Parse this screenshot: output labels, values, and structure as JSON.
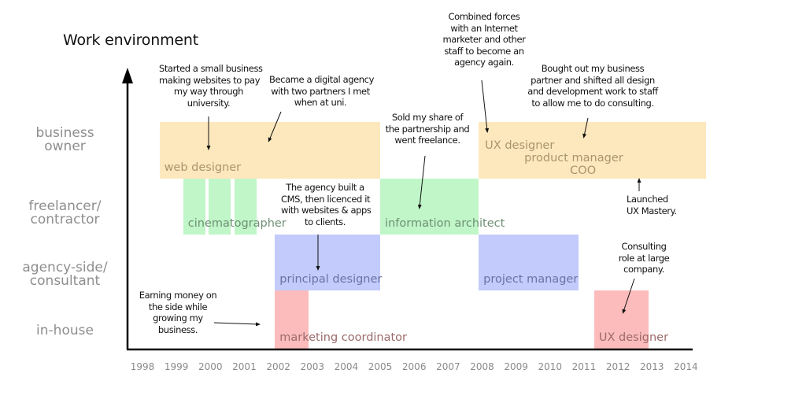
{
  "title": "Work environment",
  "colors": {
    "business_owner": "#fde8bd",
    "freelancer": "#c0f6c8",
    "agency": "#c2cbfb",
    "in_house": "#fcbcbc",
    "label_business_owner": "#a9956b",
    "label_freelancer": "#6f8f74",
    "label_agency": "#6a73a3",
    "label_in_house": "#9c6a6a"
  },
  "rows": [
    {
      "key": "business_owner",
      "label_lines": [
        "business",
        "owner"
      ]
    },
    {
      "key": "freelancer",
      "label_lines": [
        "freelancer/",
        "contractor"
      ]
    },
    {
      "key": "agency",
      "label_lines": [
        "agency-side/",
        "consultant"
      ]
    },
    {
      "key": "in_house",
      "label_lines": [
        "in-house"
      ]
    }
  ],
  "years": [
    "1998",
    "1999",
    "2000",
    "2001",
    "2002",
    "2003",
    "2004",
    "2005",
    "2006",
    "2007",
    "2008",
    "2009",
    "2010",
    "2011",
    "2012",
    "2013",
    "2014"
  ],
  "chart_data": {
    "type": "timeline",
    "title": "Work environment",
    "x_axis": {
      "label": "",
      "range": [
        1998,
        2014
      ]
    },
    "y_axis": {
      "categories": [
        "business owner",
        "freelancer/contractor",
        "agency-side/consultant",
        "in-house"
      ]
    },
    "segments": [
      {
        "row": "business_owner",
        "start": 1998.5,
        "end": 2005.0,
        "label": "web designer"
      },
      {
        "row": "freelancer",
        "start": 1999.2,
        "end": 1999.85,
        "label": "cinematographer"
      },
      {
        "row": "freelancer",
        "start": 1999.95,
        "end": 2000.6,
        "label": ""
      },
      {
        "row": "freelancer",
        "start": 2000.7,
        "end": 2001.35,
        "label": ""
      },
      {
        "row": "agency",
        "start": 2001.9,
        "end": 2005.0,
        "label": "principal designer"
      },
      {
        "row": "in_house",
        "start": 2001.9,
        "end": 2002.9,
        "label": "marketing coordinator"
      },
      {
        "row": "freelancer",
        "start": 2005.0,
        "end": 2007.9,
        "label": "information architect"
      },
      {
        "row": "business_owner",
        "start": 2007.9,
        "end": 2014.6,
        "label_lines": [
          "UX designer",
          "product manager",
          "COO"
        ]
      },
      {
        "row": "agency",
        "start": 2007.9,
        "end": 2010.85,
        "label": "project manager"
      },
      {
        "row": "in_house",
        "start": 2011.3,
        "end": 2012.9,
        "label": "UX designer"
      }
    ],
    "annotations": [
      {
        "text": [
          "Started a small business",
          "making websites to pay",
          "my way through",
          "university."
        ]
      },
      {
        "text": [
          "Became a digital agency",
          "with two partners I met",
          "when at uni."
        ]
      },
      {
        "text": [
          "The agency built a",
          "CMS, then licenced it",
          "with websites & apps",
          "to clients."
        ]
      },
      {
        "text": [
          "Earning money on",
          "the side while",
          "growing my",
          "business."
        ]
      },
      {
        "text": [
          "Sold my share of",
          "the partnership and",
          "went freelance."
        ]
      },
      {
        "text": [
          "Combined forces",
          "with an Internet",
          "marketer and other",
          "staff to become an",
          "agency again."
        ]
      },
      {
        "text": [
          "Bought out my business",
          "partner and shifted all design",
          "and development work to staff",
          "to allow me to do consulting."
        ]
      },
      {
        "text": [
          "Launched",
          "UX Mastery."
        ]
      },
      {
        "text": [
          "Consulting",
          "role at large",
          "company."
        ]
      }
    ]
  }
}
